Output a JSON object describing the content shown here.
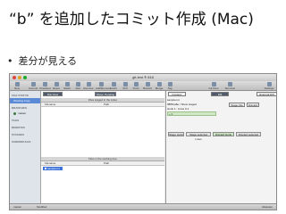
{
  "slide": {
    "title": "“b” を追加したコミット作成 (Mac)",
    "bullet": "差分が見える"
  },
  "window": {
    "title": "git-test ® 818",
    "toolbar": [
      "New",
      "Commit",
      "Checkout",
      "Reset",
      "Stash",
      "Add",
      "Remove",
      "Add/Remove",
      "Fetch",
      "Pull",
      "Push",
      "Branch",
      "Merge",
      "Tag",
      "Git Flow",
      "Terminal",
      "Settings"
    ],
    "sidebar": {
      "file_status_header": "FILE STATUS",
      "working_copy": "Working Copy",
      "branches_header": "BRANCHES",
      "branch": "master",
      "tags_header": "TAGS",
      "remotes_header": "REMOTES",
      "stashes_header": "STASHES",
      "submodules_header": "SUBMODULES"
    },
    "center": {
      "view_label": "Flat View",
      "show_label": "Show: Pending",
      "staged_header": "Files staged in the index",
      "working_header": "Files in the working tree",
      "col_filename": "Filename",
      "col_path": "Path",
      "working_files": [
        {
          "name": "sample.txt",
          "path": ""
        }
      ]
    },
    "right": {
      "btn_context": "Context:",
      "btn_diff": "Diff",
      "btn_external": "External Diff",
      "filename": "sample.txt",
      "hunk1_header": "ff8ff5ca8e / Show staged",
      "btn_stage": "Stage File",
      "btn_discard": "Discard",
      "hunk2_header": "Hunk 1 : Lines 0-1",
      "added_line": "+ b",
      "btn_stage_hunk": "Stage Hunk",
      "btn_stage_lines": "Stage selected Lines",
      "btn_discard_hunk": "Discard Hunk",
      "btn_discard_lines": "Discard selected"
    },
    "statusbar": {
      "left": "master",
      "middle": "Modified",
      "right": "Atlassian"
    }
  },
  "colors": {
    "selection": "#3d74d9",
    "added": "#cfe7c4",
    "toolbar_dark": "#4f5a6b"
  }
}
